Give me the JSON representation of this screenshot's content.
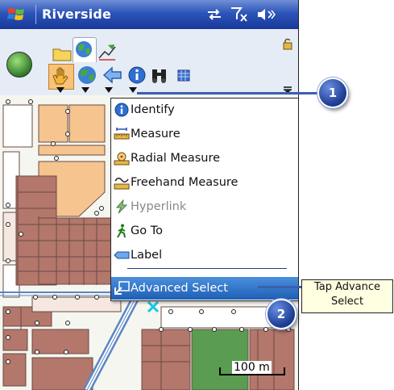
{
  "titlebar": {
    "title": "Riverside",
    "icons": [
      "connectivity-icon",
      "no-signal-icon",
      "volume-icon"
    ]
  },
  "toolbar": {
    "tabs": [
      "folder-tab-icon",
      "map-tab-icon",
      "draw-tab-icon"
    ],
    "tools": [
      "pan-tool-icon",
      "globe-tool-icon",
      "back-arrow-icon",
      "info-icon",
      "binoculars-icon",
      "grid-icon"
    ]
  },
  "menu": {
    "items": [
      {
        "label": "Identify",
        "icon": "info-icon",
        "enabled": true
      },
      {
        "label": "Measure",
        "icon": "ruler-icon",
        "enabled": true
      },
      {
        "label": "Radial Measure",
        "icon": "radial-ruler-icon",
        "enabled": true
      },
      {
        "label": "Freehand Measure",
        "icon": "freehand-ruler-icon",
        "enabled": true
      },
      {
        "label": "Hyperlink",
        "icon": "lightning-icon",
        "enabled": false
      },
      {
        "label": "Go To",
        "icon": "walking-person-icon",
        "enabled": true
      },
      {
        "label": "Label",
        "icon": "label-icon",
        "enabled": true
      }
    ],
    "selected_item": {
      "label": "Advanced Select",
      "icon": "select-arrow-icon"
    }
  },
  "callouts": {
    "badge1": "1",
    "badge2": "2",
    "tooltip_line1": "Tap Advance",
    "tooltip_line2": "Select"
  },
  "map": {
    "scale_label": "100 m"
  },
  "colors": {
    "title_blue": "#17399a",
    "menu_highlight": "#1e5fb4",
    "parcel_brown": "#b3776b",
    "parcel_tan": "#f5c48f",
    "parcel_green": "#5a9c52",
    "road_blue": "#5b86c4"
  }
}
